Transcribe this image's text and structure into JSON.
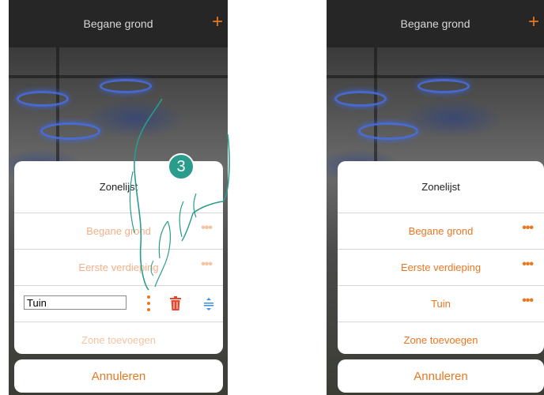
{
  "left_screen": {
    "header_title": "Begane grond",
    "add_glyph": "+",
    "dialog_title": "Zonelijst",
    "zones": [
      {
        "label": "Begane grond",
        "menu_glyph": "•••"
      },
      {
        "label": "Eerste verdieping",
        "menu_glyph": "•••"
      }
    ],
    "edit_row": {
      "input_value": "Tuin"
    },
    "add_zone_label": "Zone toevoegen",
    "cancel_label": "Annuleren",
    "step_number": "3"
  },
  "right_screen": {
    "header_title": "Begane grond",
    "add_glyph": "+",
    "dialog_title": "Zonelijst",
    "zones": [
      {
        "label": "Begane grond",
        "menu_glyph": "•••"
      },
      {
        "label": "Eerste verdieping",
        "menu_glyph": "•••"
      },
      {
        "label": "Tuin",
        "menu_glyph": "•••"
      }
    ],
    "add_zone_label": "Zone toevoegen",
    "cancel_label": "Annuleren"
  },
  "colors": {
    "accent": "#e87722",
    "step_badge": "#2a9c8c",
    "trash": "#e8452c",
    "reorder": "#3a8fd9"
  }
}
